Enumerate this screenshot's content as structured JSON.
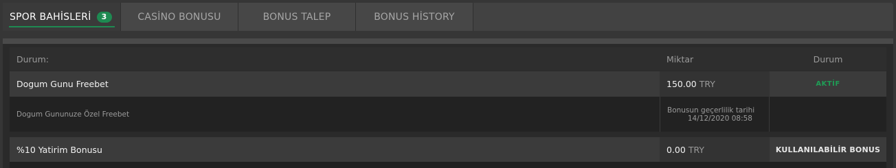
{
  "tabs": [
    {
      "label": "SPOR BAHİSLERİ",
      "badge": "3",
      "active": true
    },
    {
      "label": "CASİNO BONUSU",
      "active": false
    },
    {
      "label": "BONUS TALEP",
      "active": false
    },
    {
      "label": "BONUS HİSTORY",
      "active": false
    }
  ],
  "table": {
    "headers": {
      "status_left": "Durum:",
      "amount": "Miktar",
      "status_right": "Durum"
    },
    "bonuses": [
      {
        "name": "Dogum Gunu Freebet",
        "amount": "150.00",
        "currency": "TRY",
        "status": "AKTİF",
        "description": "Dogum Gununuze Özel Freebet",
        "validity_label": "Bonusun geçerlilik tarihi",
        "validity_date": "14/12/2020 08:58"
      },
      {
        "name": "%10 Yatirim Bonusu",
        "amount": "0.00",
        "currency": "TRY",
        "status": "KULLANILABİLİR BONUS"
      }
    ]
  },
  "colors": {
    "accent": "#1e8a52",
    "active_status": "#1f9c55",
    "background": "#363636"
  }
}
